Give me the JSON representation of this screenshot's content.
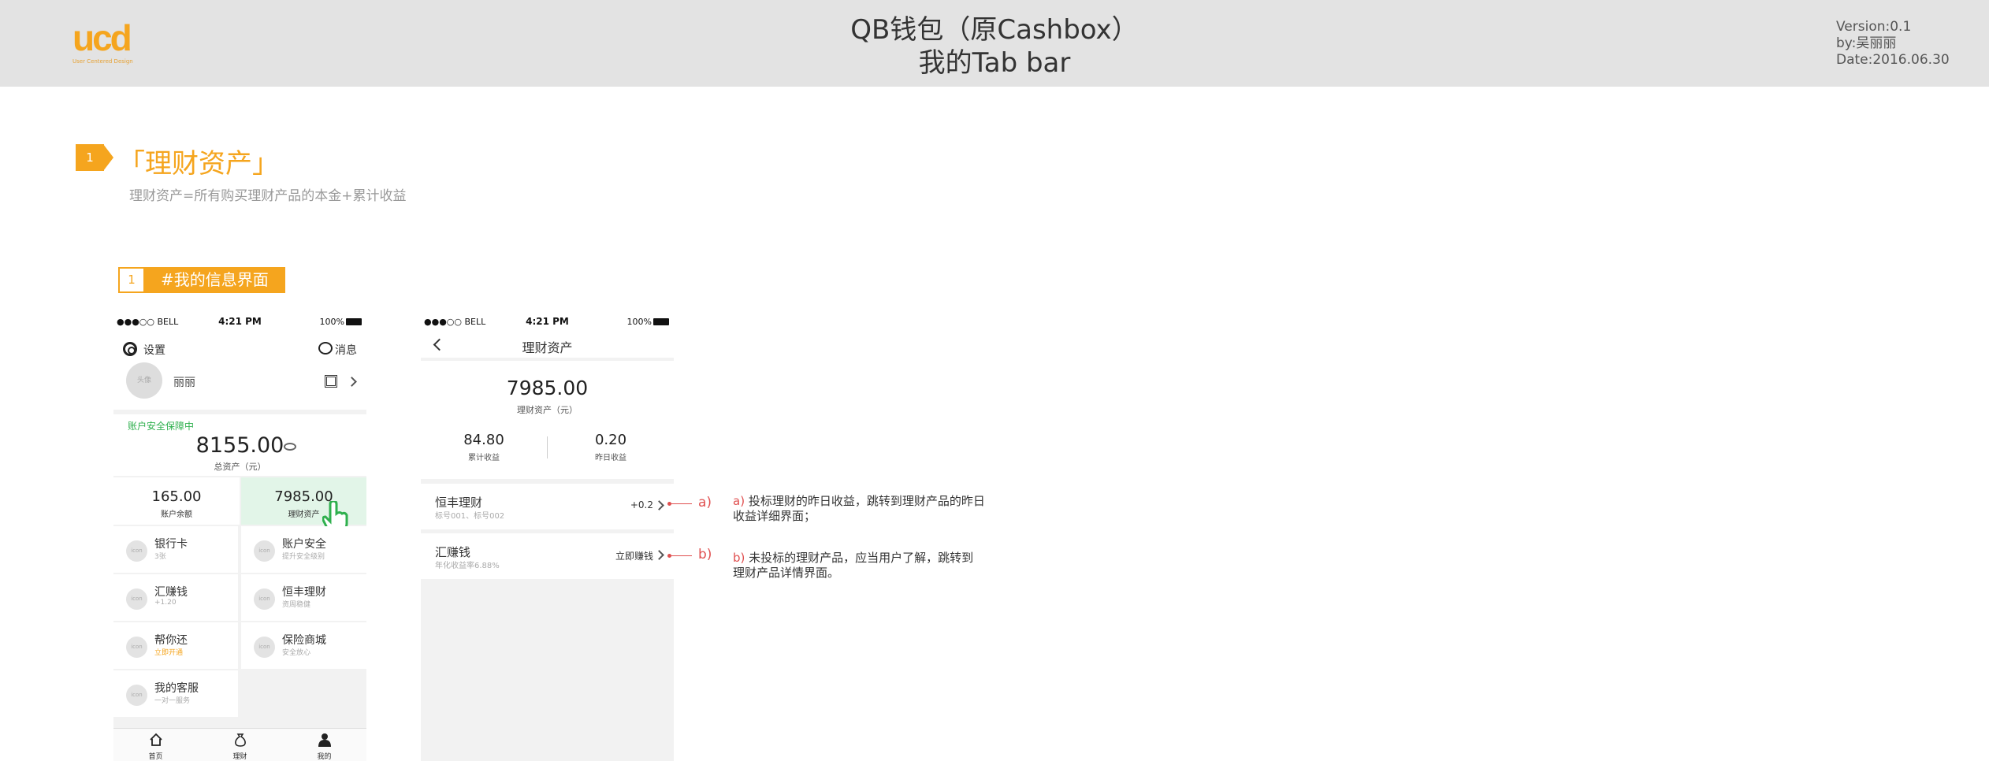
{
  "header": {
    "logo_mark": "ucd",
    "logo_tagline": "User Centered Design",
    "title_line1": "QB钱包（原Cashbox）",
    "title_line2": "我的Tab bar",
    "version": "Version:0.1",
    "author": "by:吴丽丽",
    "date": "Date:2016.06.30"
  },
  "section": {
    "number": "1",
    "title": "「理财资产」",
    "description": "理财资产=所有购买理财产品的本金+累计收益",
    "sub_number": "1",
    "sub_title": "#我的信息界面"
  },
  "status_bar": {
    "carrier": "●●●○○ BELL",
    "time": "4:21 PM",
    "battery": "100%"
  },
  "phone1": {
    "settings_label": "设置",
    "messages_label": "消息",
    "avatar_text": "头像",
    "username": "丽丽",
    "security_notice": "账户安全保障中",
    "total_amount": "8155.00",
    "total_label": "总资产（元）",
    "balance_value": "165.00",
    "balance_label": "账户余额",
    "wealth_value": "7985.00",
    "wealth_label": "理财资产",
    "icon_placeholder": "icon",
    "grid": [
      {
        "name": "银行卡",
        "sub": "3张"
      },
      {
        "name": "账户安全",
        "sub": "提升安全级别"
      },
      {
        "name": "汇赚钱",
        "sub": "+1.20"
      },
      {
        "name": "恒丰理财",
        "sub": "资周稳健"
      },
      {
        "name": "帮你还",
        "sub": "立即开通"
      },
      {
        "name": "保险商城",
        "sub": "安全放心"
      },
      {
        "name": "我的客服",
        "sub": "一对一服务"
      }
    ],
    "tabs": [
      {
        "label": "首页"
      },
      {
        "label": "理财"
      },
      {
        "label": "我的"
      }
    ]
  },
  "phone2": {
    "nav_title": "理财资产",
    "amount": "7985.00",
    "amount_label": "理财资产（元）",
    "cumulative_value": "84.80",
    "cumulative_label": "累计收益",
    "yesterday_value": "0.20",
    "yesterday_label": "昨日收益",
    "products": [
      {
        "name": "恒丰理财",
        "sub": "标号001、标号002",
        "right": "+0.2"
      },
      {
        "name": "汇赚钱",
        "sub": "年化收益率6.88%",
        "right": "立即赚钱"
      }
    ]
  },
  "annotations": [
    {
      "key": "a)",
      "label": "a)",
      "text": " 投标理财的昨日收益，跳转到理财产品的昨日收益详细界面；"
    },
    {
      "key": "b)",
      "label": "b)",
      "text": " 未投标的理财产品，应当用户了解，跳转到理财产品详情界面。"
    }
  ],
  "colors": {
    "accent": "#f5a51e",
    "annotation": "#e05050",
    "highlight_cell": "#e2f5e8",
    "safe_green": "#2fb04e"
  }
}
